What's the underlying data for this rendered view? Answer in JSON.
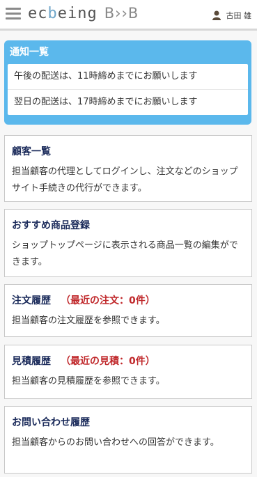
{
  "header": {
    "logo": {
      "ec": "ec",
      "b_accent": "b",
      "eing": "eing",
      "b2b": "B››B"
    },
    "user_name": "古田 雄"
  },
  "notices": {
    "title": "通知一覧",
    "items": [
      "午後の配送は、11時締めまでにお願いします",
      "翌日の配送は、17時締めまでにお願いします"
    ]
  },
  "cards": [
    {
      "title": "顧客一覧",
      "count": "",
      "desc": "担当顧客の代理としてログインし、注文などのショップサイト手続きの代行ができます。"
    },
    {
      "title": "おすすめ商品登録",
      "count": "",
      "desc": "ショップトップページに表示される商品一覧の編集ができます。"
    },
    {
      "title": "注文履歴",
      "count": "（最近の注文：0件）",
      "desc": "担当顧客の注文履歴を参照できます。"
    },
    {
      "title": "見積履歴",
      "count": "（最近の見積：0件）",
      "desc": "担当顧客の見積履歴を参照できます。"
    },
    {
      "title": "お問い合わせ履歴",
      "count": "",
      "desc": "担当顧客からのお問い合わせへの回答ができます。"
    }
  ],
  "colors": {
    "notice_bg": "#5bb8ec",
    "title_color": "#1a2a5a",
    "count_color": "#c0282b"
  }
}
